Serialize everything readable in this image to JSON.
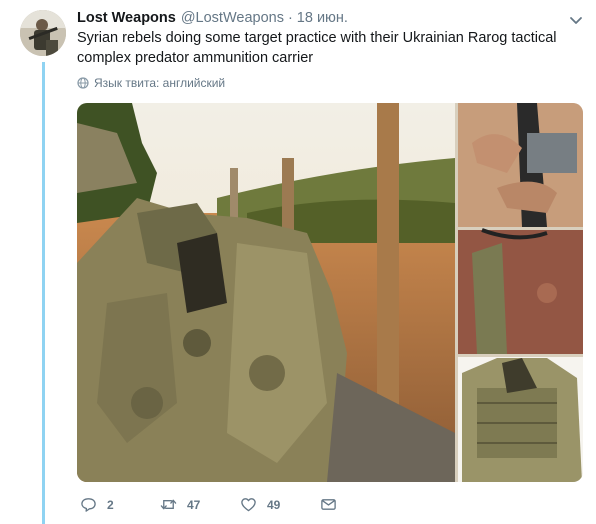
{
  "tweet": {
    "display_name": "Lost Weapons",
    "handle": "@LostWeapons",
    "separator": "·",
    "date": "18 июн.",
    "text": "Syrian rebels doing some target practice with their Ukrainian Rarog tactical complex predator ammunition carrier",
    "translate_label": "Язык твита: английский"
  },
  "actions": {
    "replies": "2",
    "retweets": "47",
    "likes": "49"
  },
  "colors": {
    "thread_line": "#8fd3f2",
    "secondary_text": "#657786",
    "primary_text": "#14171a"
  },
  "icons": [
    "chevron-down-icon",
    "globe-icon",
    "reply-icon",
    "retweet-icon",
    "like-icon",
    "message-icon"
  ]
}
